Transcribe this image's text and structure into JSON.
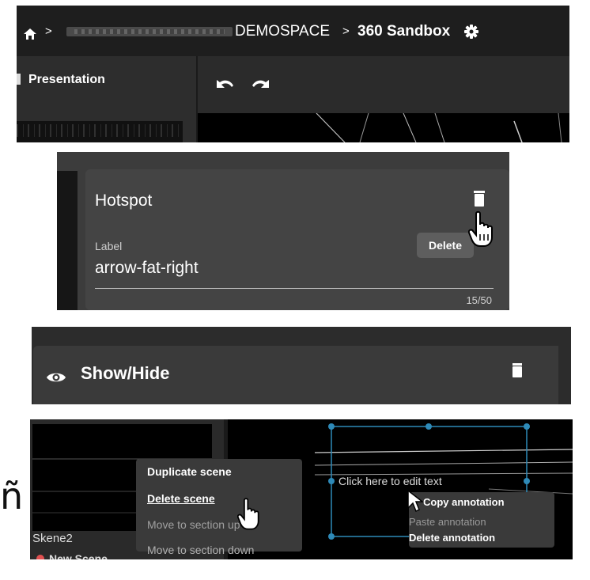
{
  "panel1": {
    "breadcrumb": {
      "separator1": ">",
      "space_suffix": "DEMOSPACE",
      "separator2": ">",
      "project": "360 Sandbox"
    },
    "sidebar_tab": "Presentation"
  },
  "panel2": {
    "title": "Hotspot",
    "field_label": "Label",
    "field_value": "arrow-fat-right",
    "char_count": "15/50",
    "tooltip": "Delete"
  },
  "panel3": {
    "label": "Show/Hide"
  },
  "panel4": {
    "scene_label": "Skene2",
    "new_scene": "New Scene",
    "scene_menu": [
      "Duplicate scene",
      "Delete scene",
      "Move to section up",
      "Move to section down"
    ],
    "text_placeholder": "Click here to edit text",
    "annotation_menu": [
      "Copy annotation",
      "Paste annotation",
      "Delete annotation"
    ]
  },
  "outside_char": "ñ",
  "colors": {
    "accent_handle": "#2e8ab8",
    "menu_bg": "#3a3a3a"
  }
}
